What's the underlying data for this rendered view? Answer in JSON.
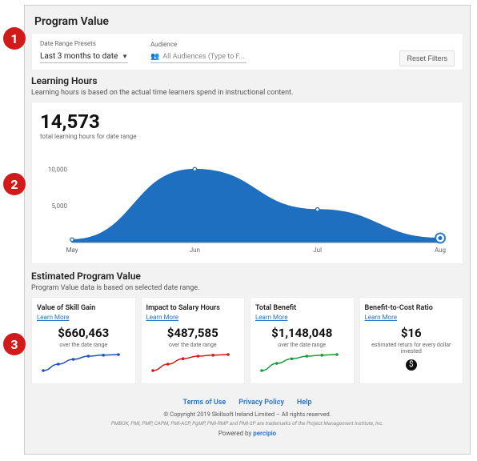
{
  "badges": [
    "1",
    "2",
    "3"
  ],
  "header": {
    "title": "Program Value"
  },
  "filters": {
    "date_label": "Date Range Presets",
    "date_value": "Last 3 months to date",
    "audience_label": "Audience",
    "audience_placeholder": "All Audiences (Type to F...",
    "reset": "Reset Filters"
  },
  "learning": {
    "title": "Learning Hours",
    "subtitle": "Learning hours is based on the actual time learners spend in instructional content.",
    "total": "14,573",
    "total_label": "total learning hours for date range"
  },
  "est": {
    "title": "Estimated Program Value",
    "subtitle": "Program Value data is based on selected date range."
  },
  "cards": [
    {
      "title": "Value of Skill Gain",
      "learn": "Learn More",
      "value": "$660,463",
      "sub": "over the date range"
    },
    {
      "title": "Impact to Salary Hours",
      "learn": "Learn More",
      "value": "$487,585",
      "sub": "over the date range"
    },
    {
      "title": "Total Benefit",
      "learn": "Learn More",
      "value": "$1,148,048",
      "sub": "over the date range"
    },
    {
      "title": "Benefit-to-Cost Ratio",
      "learn": "Learn More",
      "value": "$16",
      "sub": "estimated return for every dollar invested"
    }
  ],
  "footer": {
    "links": [
      "Terms of Use",
      "Privacy Policy",
      "Help"
    ],
    "copyright": "© Copyright 2019 Skillsoft Ireland Limited – All rights reserved.",
    "trademarks": "PMBOK, PMI, PMP, CAPM, PMI-ACP, PgMP, PMI-RMP and PMI-SP are trademarks of the Project Management Institute, Inc.",
    "powered": "Powered by",
    "brand": "percipio"
  },
  "chart_data": {
    "main": {
      "type": "area",
      "x": [
        "May",
        "Jun",
        "Jul",
        "Aug"
      ],
      "values": [
        400,
        10000,
        4500,
        600
      ],
      "ylim": [
        0,
        12000
      ],
      "yticks": [
        5000,
        10000
      ],
      "ytick_labels": [
        "5,000",
        "10,000"
      ],
      "color": "#1e6fc0"
    },
    "minis": [
      {
        "type": "line",
        "x": [
          0,
          1,
          2,
          3,
          4,
          5
        ],
        "values": [
          5,
          25,
          40,
          50,
          53,
          55
        ],
        "color": "#1e4fc0"
      },
      {
        "type": "line",
        "x": [
          0,
          1,
          2,
          3,
          4,
          5
        ],
        "values": [
          5,
          25,
          42,
          50,
          53,
          55
        ],
        "color": "#d11a1a"
      },
      {
        "type": "line",
        "x": [
          0,
          1,
          2,
          3,
          4,
          5
        ],
        "values": [
          6,
          28,
          42,
          50,
          53,
          55
        ],
        "color": "#1a9a3c"
      }
    ]
  }
}
